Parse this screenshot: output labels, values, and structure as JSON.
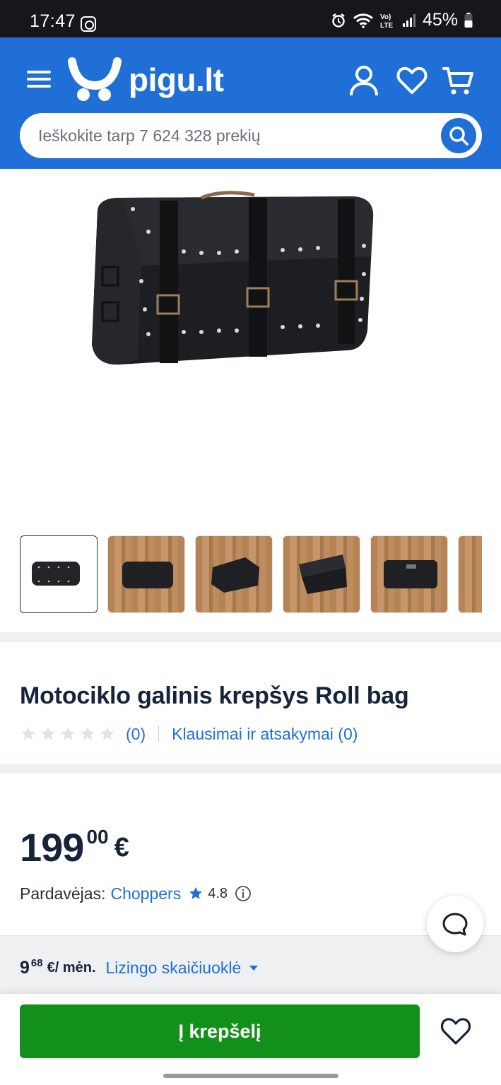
{
  "status_bar": {
    "time": "17:47",
    "battery": "45%",
    "icons": [
      "instagram-icon",
      "alarm-icon",
      "wifi-icon",
      "volte-icon",
      "signal-icon",
      "battery-icon"
    ]
  },
  "header": {
    "logo_text": "pigu.lt",
    "icons": [
      "menu-icon",
      "user-icon",
      "heart-icon",
      "cart-icon"
    ],
    "search_placeholder": "Ieškokite tarp 7 624 328 prekių",
    "brand_color": "#1f6fd6"
  },
  "gallery": {
    "main_image": "motorcycle-roll-bag-image",
    "thumbnails": [
      "roll-bag-white",
      "roll-bag-wood-front",
      "roll-bag-wood-angle",
      "roll-bag-wood-open",
      "roll-bag-wood-top",
      "roll-bag-wood-more"
    ],
    "active_index": 0
  },
  "product": {
    "title": "Motociklo galinis krepšys Roll bag",
    "rating_stars": 0,
    "review_count": "(0)",
    "qa_link": "Klausimai ir atsakymai (0)"
  },
  "price": {
    "integer": "199",
    "decimals": "00",
    "currency": "€",
    "seller_label": "Pardavėjas:",
    "seller_name": "Choppers",
    "seller_rating": "4.8"
  },
  "leasing": {
    "integer": "9",
    "decimals": "68",
    "unit": "€/ mėn.",
    "link": "Lizingo skaičiuoklė"
  },
  "bottom_bar": {
    "cart_button": "Į krepšelį",
    "accent_color": "#12901a"
  }
}
